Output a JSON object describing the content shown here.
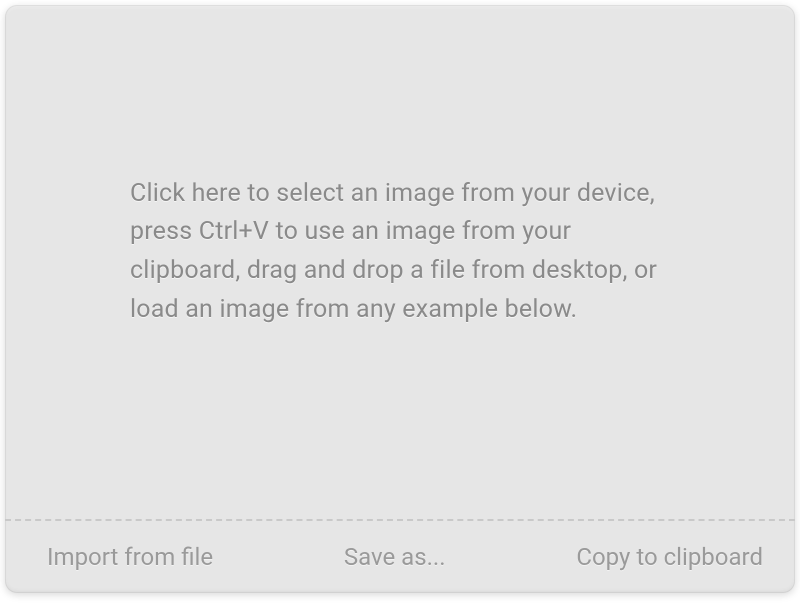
{
  "dropzone": {
    "instruction": "Click here to select an image from your device, press Ctrl+V to use an image from your clipboard, drag and drop a file from desktop, or load an image from any example below."
  },
  "footer": {
    "import_label": "Import from file",
    "save_label": "Save as...",
    "copy_label": "Copy to clipboard"
  }
}
